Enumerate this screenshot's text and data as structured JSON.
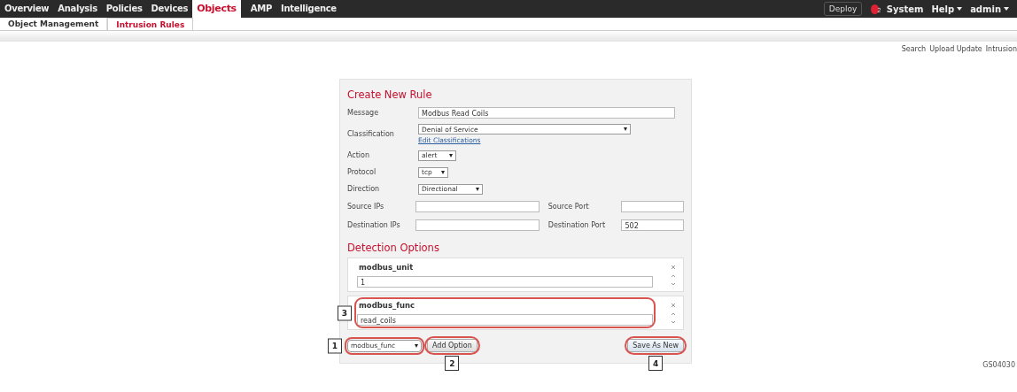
{
  "top_nav": {
    "tabs": [
      {
        "label": "Overview",
        "selected": false
      },
      {
        "label": "Analysis",
        "selected": false
      },
      {
        "label": "Policies",
        "selected": false
      },
      {
        "label": "Devices",
        "selected": false
      },
      {
        "label": "Objects",
        "selected": true
      },
      {
        "label": "AMP",
        "selected": false
      },
      {
        "label": "Intelligence",
        "selected": false
      }
    ],
    "deploy": "Deploy",
    "alert_count": "2",
    "menus": [
      {
        "label": "System",
        "dropdown": false
      },
      {
        "label": "Help",
        "dropdown": true
      },
      {
        "label": "admin",
        "dropdown": true
      }
    ]
  },
  "sub_nav": {
    "tabs": [
      {
        "label": "Object Management",
        "selected": false
      },
      {
        "label": "Intrusion Rules",
        "selected": true
      }
    ]
  },
  "toolbar": [
    "Search",
    "Upload Update",
    "Intrusion"
  ],
  "form": {
    "title": "Create New Rule",
    "fields": [
      {
        "kind": "text",
        "label": "Message",
        "value": "Modbus Read Coils"
      },
      {
        "kind": "select",
        "label": "Classification",
        "value": "Denial of Service",
        "link": "Edit Classifications"
      },
      {
        "kind": "select",
        "label": "Action",
        "value": "alert"
      },
      {
        "kind": "select",
        "label": "Protocol",
        "value": "tcp"
      },
      {
        "kind": "select",
        "label": "Direction",
        "value": "Directional"
      },
      {
        "kind": "pair",
        "label": "Source IPs",
        "label2": "Source Port"
      },
      {
        "kind": "pair",
        "label": "Destination IPs",
        "label2": "Destination Port",
        "value2": "502"
      }
    ],
    "detection_title": "Detection Options",
    "options": [
      {
        "name": "modbus_unit",
        "value": "1"
      },
      {
        "name": "modbus_func",
        "value": "read_coils",
        "callout": "3"
      }
    ],
    "option_select": {
      "value": "modbus_func",
      "callout": "1"
    },
    "add_button": {
      "label": "Add Option",
      "callout": "2"
    },
    "save_button": {
      "label": "Save As New",
      "callout": "4"
    }
  },
  "figure_id": "GS04030"
}
